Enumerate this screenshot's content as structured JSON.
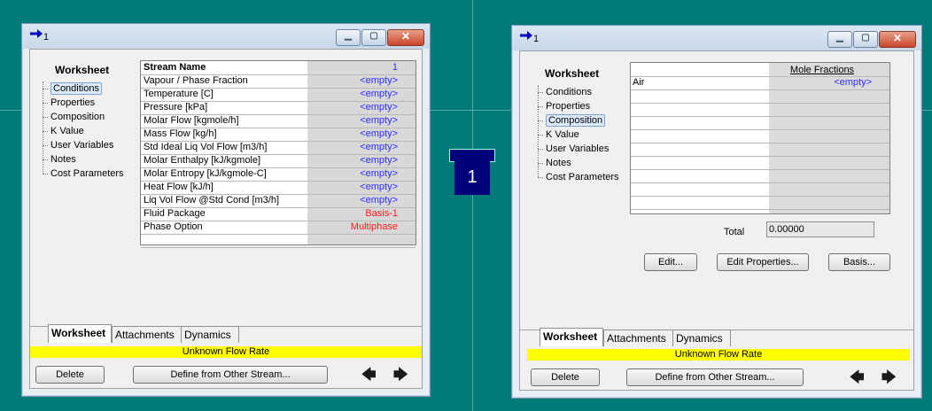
{
  "colors": {
    "background": "#007a78",
    "status": "#ffff00",
    "value_blue": "#2d2dff",
    "value_red": "#ff1a1a",
    "badge": "#00007a"
  },
  "center_badge": {
    "label": "1"
  },
  "left_window": {
    "title": "1",
    "sidebar": {
      "heading": "Worksheet",
      "items": [
        "Conditions",
        "Properties",
        "Composition",
        "K Value",
        "User Variables",
        "Notes",
        "Cost Parameters"
      ],
      "selected": "Conditions"
    },
    "rows": [
      {
        "label": "Stream Name",
        "value": "1"
      },
      {
        "label": "Vapour / Phase Fraction",
        "value": "<empty>"
      },
      {
        "label": "Temperature [C]",
        "value": "<empty>"
      },
      {
        "label": "Pressure [kPa]",
        "value": "<empty>"
      },
      {
        "label": "Molar Flow [kgmole/h]",
        "value": "<empty>"
      },
      {
        "label": "Mass Flow [kg/h]",
        "value": "<empty>"
      },
      {
        "label": "Std Ideal Liq Vol Flow [m3/h]",
        "value": "<empty>"
      },
      {
        "label": "Molar Enthalpy [kJ/kgmole]",
        "value": "<empty>"
      },
      {
        "label": "Molar Entropy [kJ/kgmole-C]",
        "value": "<empty>"
      },
      {
        "label": "Heat Flow [kJ/h]",
        "value": "<empty>"
      },
      {
        "label": "Liq Vol Flow @Std Cond [m3/h]",
        "value": "<empty>"
      },
      {
        "label": "Fluid Package",
        "value": "Basis-1"
      },
      {
        "label": "Phase Option",
        "value": "Multiphase"
      }
    ],
    "tabs": [
      "Worksheet",
      "Attachments",
      "Dynamics"
    ],
    "status": "Unknown Flow Rate",
    "buttons": {
      "delete": "Delete",
      "define": "Define from Other Stream..."
    }
  },
  "right_window": {
    "title": "1",
    "sidebar": {
      "heading": "Worksheet",
      "items": [
        "Conditions",
        "Properties",
        "Composition",
        "K Value",
        "User Variables",
        "Notes",
        "Cost Parameters"
      ],
      "selected": "Composition"
    },
    "column_header": "Mole Fractions",
    "component": {
      "name": "Air",
      "value": "<empty>"
    },
    "total_label": "Total",
    "total_value": "0.00000",
    "buttons": {
      "edit": "Edit...",
      "edit_properties": "Edit Properties...",
      "basis": "Basis...",
      "delete": "Delete",
      "define": "Define from Other Stream..."
    },
    "tabs": [
      "Worksheet",
      "Attachments",
      "Dynamics"
    ],
    "status": "Unknown Flow Rate"
  }
}
